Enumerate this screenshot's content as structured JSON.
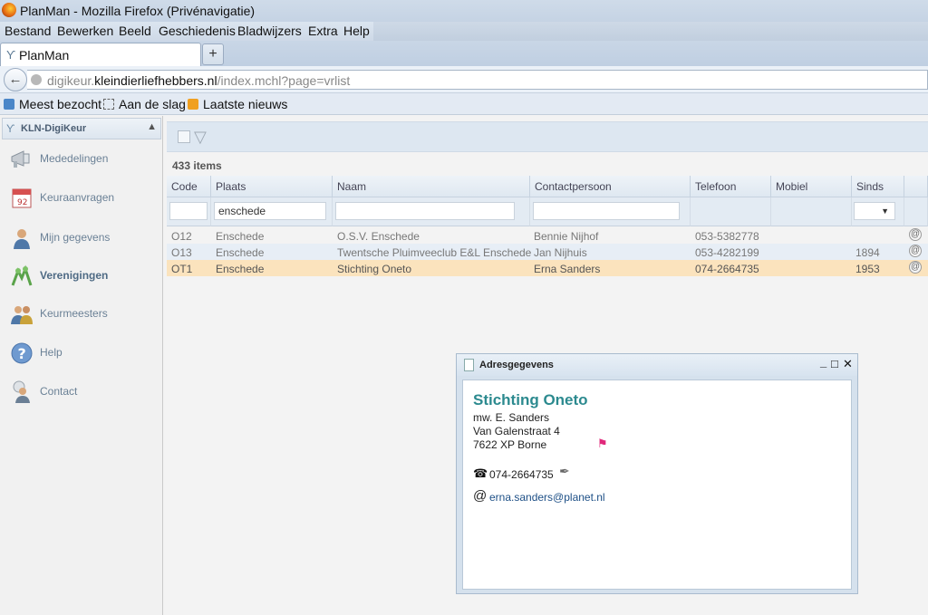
{
  "window": {
    "title": "PlanMan - Mozilla Firefox (Privénavigatie)"
  },
  "menu": [
    "Bestand",
    "Bewerken",
    "Beeld",
    "Geschiedenis",
    "Bladwijzers",
    "Extra",
    "Help"
  ],
  "tab": {
    "label": "PlanMan",
    "new_tab": "+"
  },
  "url": {
    "pre": "digikeur.",
    "domain": "kleindierliefhebbers.nl",
    "path": "/index.mchl?page=vrlist"
  },
  "bookmarks": [
    "Meest bezocht",
    "Aan de slag",
    "Laatste nieuws"
  ],
  "sidebar": {
    "header": "KLN-DigiKeur",
    "items": [
      {
        "label": "Mededelingen",
        "icon": "megaphone-icon"
      },
      {
        "label": "Keuraanvragen",
        "icon": "calendar-icon"
      },
      {
        "label": "Mijn gegevens",
        "icon": "user-icon"
      },
      {
        "label": "Verenigingen",
        "icon": "group-icon",
        "active": true
      },
      {
        "label": "Keurmeesters",
        "icon": "users-icon"
      },
      {
        "label": "Help",
        "icon": "help-icon"
      },
      {
        "label": "Contact",
        "icon": "contact-icon"
      }
    ]
  },
  "list": {
    "count": "433 items",
    "columns": [
      "Code",
      "Plaats",
      "Naam",
      "Contactpersoon",
      "Telefoon",
      "Mobiel",
      "Sinds"
    ],
    "filters": {
      "plaats": "enschede"
    },
    "rows": [
      [
        "O12",
        "Enschede",
        "O.S.V. Enschede",
        "Bennie Nijhof",
        "053-5382778",
        "",
        ""
      ],
      [
        "O13",
        "Enschede",
        "Twentsche Pluimveeclub E&L Enschede",
        "Jan Nijhuis",
        "053-4282199",
        "",
        "1894"
      ],
      [
        "OT1",
        "Enschede",
        "Stichting Oneto",
        "Erna Sanders",
        "074-2664735",
        "",
        "1953"
      ]
    ]
  },
  "popup": {
    "title": "Adresgegevens",
    "name": "Stichting Oneto",
    "contact": "mw. E. Sanders",
    "street": "Van Galenstraat 4",
    "city": "7622 XP Borne",
    "phone": "074-2664735",
    "email": "erna.sanders@planet.nl"
  },
  "colors": {
    "accent": "#2c8a8f",
    "selected_row": "#fbe3bd",
    "link": "#1d4f86"
  }
}
